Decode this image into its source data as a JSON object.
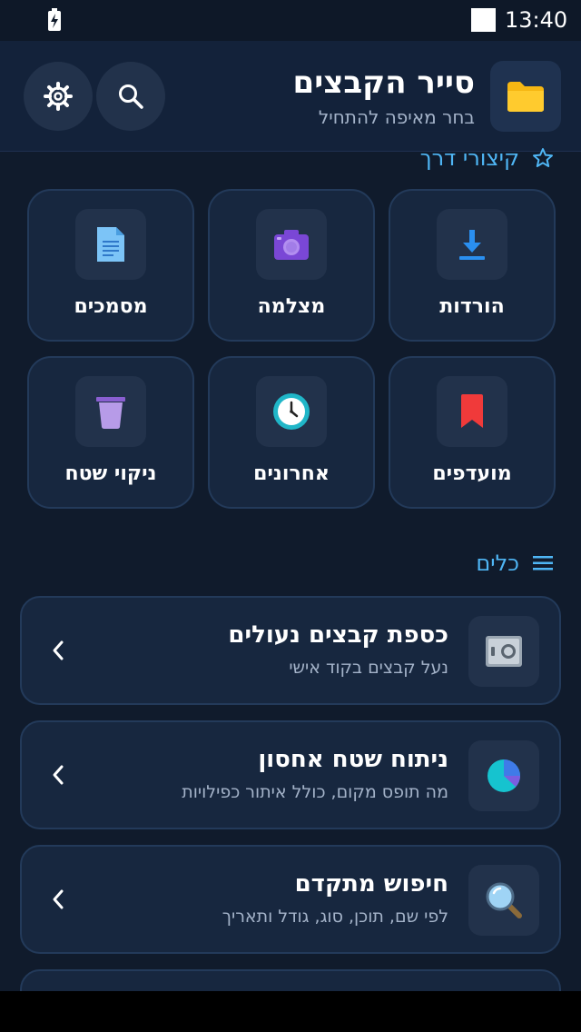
{
  "status_bar": {
    "time": "13:40"
  },
  "header": {
    "title": "סייר הקבצים",
    "subtitle": "בחר מאיפה להתחיל"
  },
  "shortcuts": {
    "heading": "קיצורי דרך",
    "items": [
      {
        "label": "הורדות",
        "icon": "download-icon"
      },
      {
        "label": "מצלמה",
        "icon": "camera-icon"
      },
      {
        "label": "מסמכים",
        "icon": "document-icon"
      },
      {
        "label": "מועדפים",
        "icon": "bookmark-icon"
      },
      {
        "label": "אחרונים",
        "icon": "clock-icon"
      },
      {
        "label": "ניקוי שטח",
        "icon": "trash-icon"
      }
    ]
  },
  "tools": {
    "heading": "כלים",
    "items": [
      {
        "title": "כספת קבצים נעולים",
        "subtitle": "נעל קבצים בקוד אישי",
        "icon": "safe-icon"
      },
      {
        "title": "ניתוח שטח אחסון",
        "subtitle": "מה תופס מקום, כולל איתור כפילויות",
        "icon": "pie-chart-icon"
      },
      {
        "title": "חיפוש מתקדם",
        "subtitle": "לפי שם, תוכן, סוג, גודל ותאריך",
        "icon": "magnifier-icon"
      }
    ]
  },
  "colors": {
    "accent": "#4fb6f5",
    "background": "#101b2c",
    "card": "#17273f"
  }
}
